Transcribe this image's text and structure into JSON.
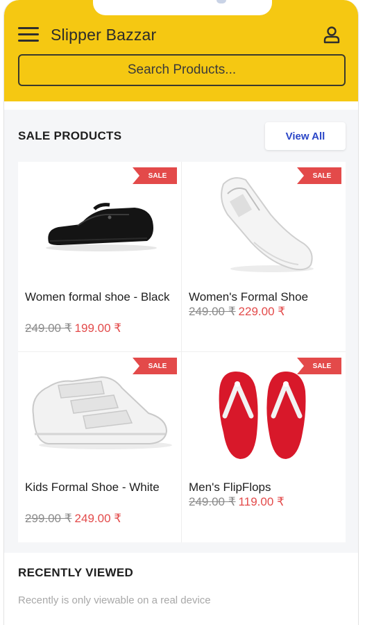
{
  "header": {
    "title": "Slipper Bazzar",
    "menu_icon": "hamburger-menu-icon",
    "user_icon": "user-profile-icon",
    "background": "#f5c812"
  },
  "search": {
    "placeholder": "Search Products..."
  },
  "sale_section": {
    "title": "SALE PRODUCTS",
    "view_all_label": "View All",
    "products": [
      {
        "name": "Women formal shoe - Black",
        "badge": "SALE",
        "old_price": "249.00 ₹",
        "new_price": "199.00 ₹",
        "icon": "black-formal-shoe"
      },
      {
        "name": "Women's Formal Shoe",
        "badge": "SALE",
        "old_price": "249.00 ₹",
        "new_price": "229.00 ₹",
        "icon": "white-formal-shoe"
      },
      {
        "name": "Kids Formal Shoe - White",
        "badge": "SALE",
        "old_price": "299.00 ₹",
        "new_price": "249.00 ₹",
        "icon": "white-velcro-shoe"
      },
      {
        "name": "Men's FlipFlops",
        "badge": "SALE",
        "old_price": "249.00 ₹",
        "new_price": "119.00 ₹",
        "icon": "red-flipflops"
      }
    ]
  },
  "recent_section": {
    "title": "RECENTLY VIEWED",
    "note": "Recently is only viewable on a real device"
  },
  "colors": {
    "accent": "#f5c812",
    "sale": "#e34a4a",
    "link": "#2a46c7"
  }
}
